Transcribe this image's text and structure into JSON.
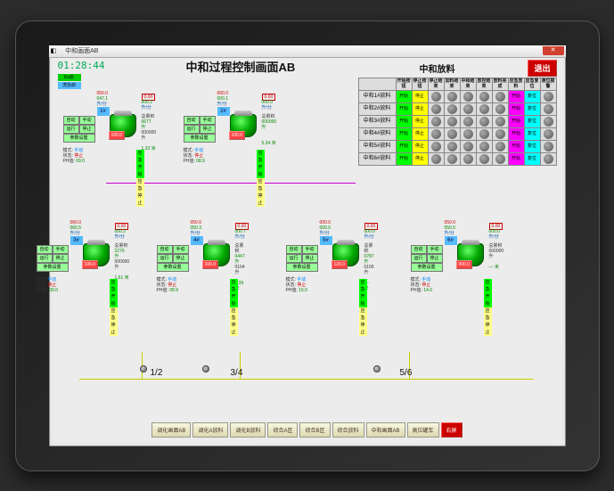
{
  "window_title": "中和画面AB",
  "clock": "01:28:44",
  "main_title": "中和过程控制画面AB",
  "sub_title": "中和放料",
  "exit": "退出",
  "indicator1": "Kx启",
  "indicator2": "洗协启",
  "table": {
    "cols": [
      "开始按钮",
      "停止按钮",
      "停止结束",
      "加料结束",
      "中和结束",
      "放控结束",
      "放料完成",
      "应急放料",
      "应急复位",
      "液位报警"
    ],
    "rows": [
      "中和1#放料",
      "中和2#放料",
      "中和3#放料",
      "中和4#放料",
      "中和5#放料",
      "中和6#放料"
    ],
    "start": "开始",
    "stop": "停止",
    "reset": "复位"
  },
  "buttons": {
    "auto": "自动",
    "manual": "手动",
    "run": "运行",
    "stop": "停止",
    "params": "参数设置",
    "mode": "模式",
    "state": "状态",
    "ph": "PH值",
    "em_start": "应急开始",
    "em_stop": "应急停止"
  },
  "tanks": [
    {
      "id": "1#",
      "val1": "050.0",
      "val2": "047.1",
      "unit": "升/分",
      "flow1": "0.00",
      "flow2": "000.2",
      "total": "0677 升",
      "left": "000000 升",
      "level": "1.33 米",
      "mode": "手动",
      "state": "停止",
      "ph": "09.0",
      "redval": "100.0"
    },
    {
      "id": "2#",
      "val1": "060.0",
      "val2": "000.1",
      "unit": "升/分",
      "flow1": "0.00",
      "flow2": "000.0",
      "total": "000000 升",
      "left": "",
      "level": "5.34 米",
      "mode": "手动",
      "state": "停止",
      "ph": "08.9",
      "redval": "100.0"
    },
    {
      "id": "3#",
      "val1": "060.0",
      "val2": "060.5",
      "unit": "升/分",
      "flow1": "0.00",
      "flow2": "000.2",
      "total": "2276 升",
      "left": "000000 升",
      "level": "1.61 米",
      "mode": "手动",
      "state": "停止",
      "ph": "09.0",
      "redval": "100.0"
    },
    {
      "id": "4#",
      "val1": "050.0",
      "val2": "050.3",
      "unit": "升/分",
      "flow1": "0.00",
      "flow2": "000.7",
      "total": "0447 升",
      "left": "0104 升",
      "level": "1.39 米",
      "mode": "手动",
      "state": "停止",
      "ph": "08.9",
      "redval": "100.0"
    },
    {
      "id": "5#",
      "val1": "000.0",
      "val2": "000.0",
      "unit": "升/分",
      "flow1": "0.00",
      "flow2": "000.0",
      "total": "0787 升",
      "left": "0106 升",
      "level": "— 米",
      "mode": "手动",
      "state": "停止",
      "ph": "15.0",
      "redval": "120.0"
    },
    {
      "id": "6#",
      "val1": "050.0",
      "val2": "050.5",
      "unit": "升/分",
      "flow1": "0.00",
      "flow2": "000.0",
      "total": "",
      "left": "000000 升",
      "level": "— 米",
      "mode": "手动",
      "state": "停止",
      "ph": "14.0",
      "redval": "000.0"
    }
  ],
  "mid_labels": [
    "1/2",
    "3/4",
    "5/6"
  ],
  "bottom": [
    "调化画面AB",
    "调化A放料",
    "调化B放料",
    "综合A区",
    "综合B区",
    "综合放料",
    "中和画面AB",
    "高位罐车",
    "右屏"
  ]
}
